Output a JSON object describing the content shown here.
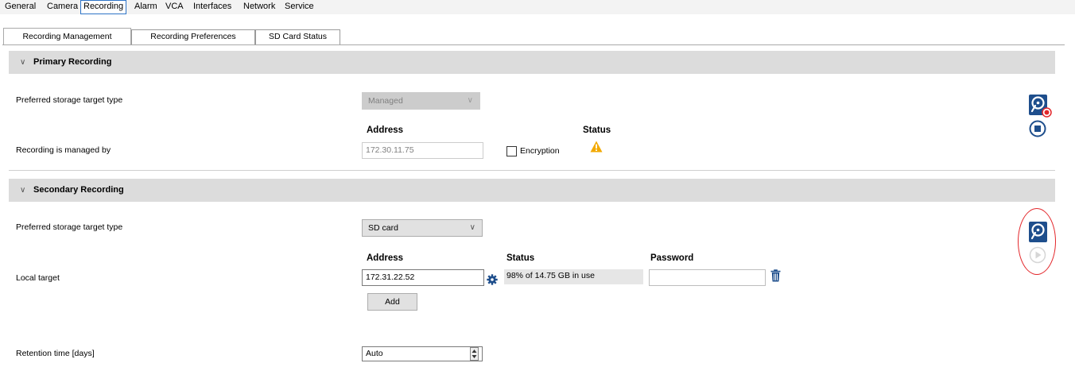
{
  "menu": {
    "items": [
      {
        "label": "General"
      },
      {
        "label": "Camera"
      },
      {
        "label": "Recording"
      },
      {
        "label": "Alarm"
      },
      {
        "label": "VCA"
      },
      {
        "label": "Interfaces"
      },
      {
        "label": "Network"
      },
      {
        "label": "Service"
      }
    ],
    "active": "Recording"
  },
  "tabs": [
    {
      "label": "Recording Management"
    },
    {
      "label": "Recording Preferences"
    },
    {
      "label": "SD Card Status"
    }
  ],
  "primary": {
    "title": "Primary Recording",
    "storage_label": "Preferred storage target type",
    "storage_value": "Managed",
    "address_header": "Address",
    "status_header": "Status",
    "managed_label": "Recording is managed by",
    "address_value": "172.30.11.75",
    "encryption_label": "Encryption",
    "encryption_checked": false
  },
  "secondary": {
    "title": "Secondary Recording",
    "storage_label": "Preferred storage target type",
    "storage_value": "SD card",
    "address_header": "Address",
    "status_header": "Status",
    "password_header": "Password",
    "local_target_label": "Local target",
    "address_value": "172.31.22.52",
    "status_value": "98% of 14.75 GB in use",
    "password_value": "",
    "add_label": "Add",
    "retention_label": "Retention time [days]",
    "retention_value": "Auto"
  },
  "icons": {
    "disk": "hard-disk-icon",
    "record_badge": "record-dot-icon",
    "stop": "stop-recording-icon",
    "play": "start-recording-icon",
    "warning": "warning-icon",
    "gear": "gear-icon",
    "trash": "trash-icon"
  },
  "colors": {
    "accent_blue": "#1e4e8c",
    "record_red": "#e3262a",
    "warning_amber": "#f2a900",
    "section_header": "#dcdcdc",
    "highlight_oval": "#e3262a"
  }
}
